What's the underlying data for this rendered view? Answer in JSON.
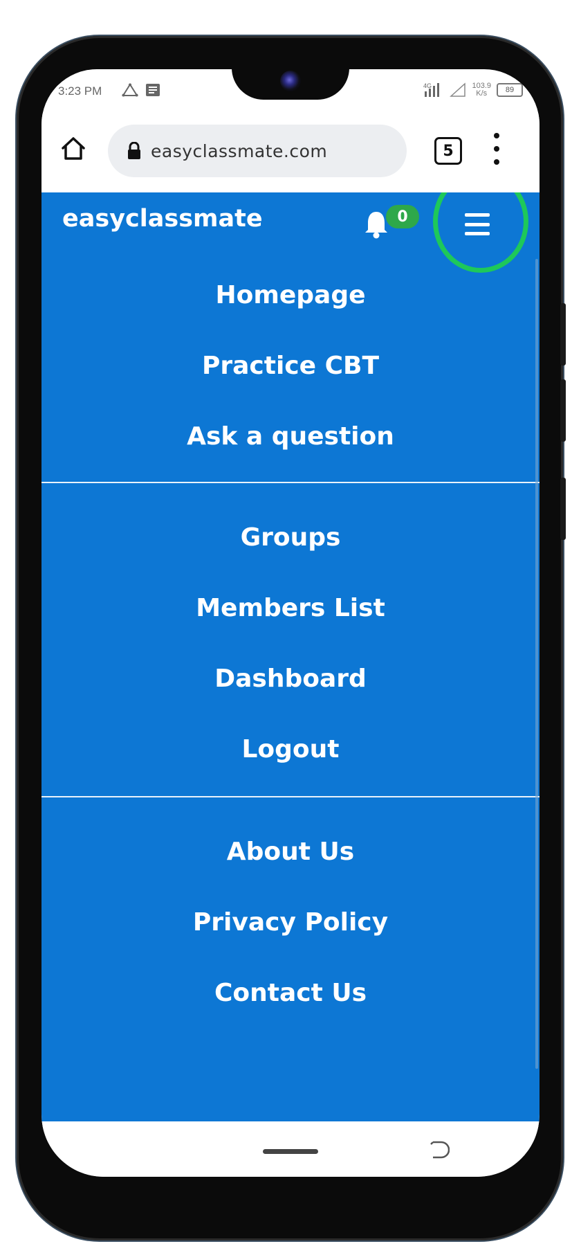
{
  "status_bar": {
    "time": "3:23 PM",
    "speed_value": "103.9",
    "speed_unit": "K/s",
    "battery": "89",
    "network": "4G"
  },
  "browser": {
    "url": "easyclassmate.com",
    "tab_count": "5"
  },
  "site": {
    "brand": "easyclassmate",
    "notification_count": "0"
  },
  "menu": {
    "group1": [
      "Homepage",
      "Practice CBT",
      "Ask a question"
    ],
    "group2": [
      "Groups",
      "Members List",
      "Dashboard",
      "Logout"
    ],
    "group3": [
      "About Us",
      "Privacy Policy",
      "Contact Us"
    ]
  },
  "colors": {
    "page_bg": "#0d77d4",
    "badge": "#2ea84a",
    "highlight": "#1ec85a"
  }
}
